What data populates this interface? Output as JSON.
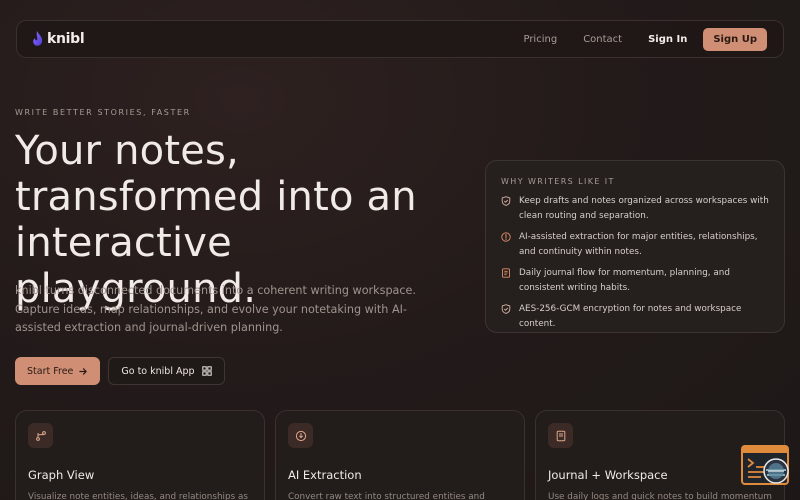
{
  "nav": {
    "brand": "knibl",
    "links": [
      "Pricing",
      "Contact"
    ],
    "signin": "Sign In",
    "signup": "Sign Up"
  },
  "hero": {
    "eyebrow": "WRITE BETTER STORIES, FASTER",
    "headline": "Your notes, transformed into an interactive playground.",
    "lead": "knibl turns disconnected documents into a coherent writing workspace. Capture ideas, map relationships, and evolve your notetaking with AI-assisted extraction and journal-driven planning.",
    "cta_primary": "Start Free",
    "cta_secondary": "Go to knibl App"
  },
  "why": {
    "title": "WHY WRITERS LIKE IT",
    "items": [
      {
        "icon": "shield-check-icon",
        "text": "Keep drafts and notes organized across workspaces with clean routing and separation."
      },
      {
        "icon": "spark-circle-icon",
        "text": "AI-assisted extraction for major entities, relationships, and continuity within notes."
      },
      {
        "icon": "journal-icon",
        "text": "Daily journal flow for momentum, planning, and consistent writing habits."
      },
      {
        "icon": "shield-check-icon",
        "text": "AES-256-GCM encryption for notes and workspace content."
      }
    ]
  },
  "features": [
    {
      "icon": "branch-icon",
      "title": "Graph View",
      "desc": "Visualize note entities, ideas, and relationships as"
    },
    {
      "icon": "extract-icon",
      "title": "AI Extraction",
      "desc": "Convert raw text into structured entities and"
    },
    {
      "icon": "journal-icon",
      "title": "Journal + Workspace",
      "desc": "Use daily logs and quick notes to build momentum"
    }
  ],
  "colors": {
    "accent": "#d08f74",
    "background": "#231b1a",
    "widget": "#e08a3c"
  }
}
